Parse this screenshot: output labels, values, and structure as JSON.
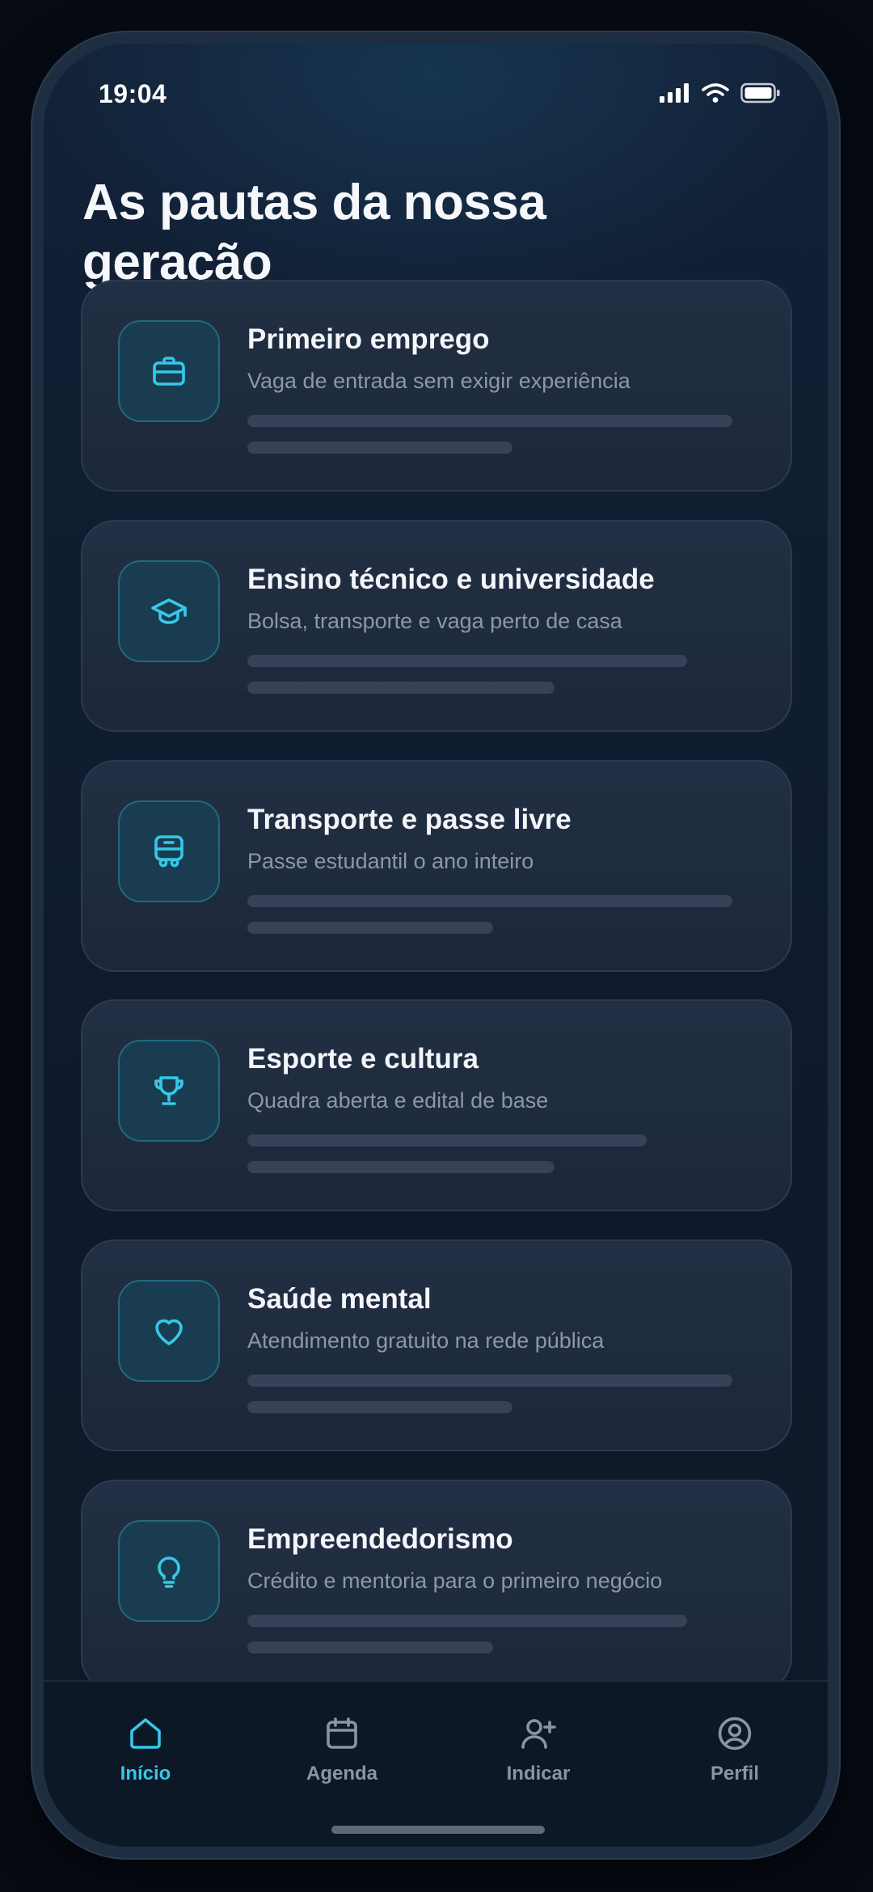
{
  "status_bar": {
    "time": "19:04",
    "icons": [
      "signal-icon",
      "wifi-icon",
      "battery-icon"
    ]
  },
  "header": {
    "title": "As pautas da nossa geração"
  },
  "cards": [
    {
      "title": "Primeiro emprego",
      "subtitle": "Vaga de entrada sem exigir experiência",
      "icon": "briefcase-icon"
    },
    {
      "title": "Ensino técnico e universidade",
      "subtitle": "Bolsa, transporte e vaga perto de casa",
      "icon": "graduation-cap-icon"
    },
    {
      "title": "Transporte e passe livre",
      "subtitle": "Passe estudantil o ano inteiro",
      "icon": "bus-icon"
    },
    {
      "title": "Esporte e cultura",
      "subtitle": "Quadra aberta e edital de base",
      "icon": "trophy-icon"
    },
    {
      "title": "Saúde mental",
      "subtitle": "Atendimento gratuito na rede pública",
      "icon": "heart-icon"
    },
    {
      "title": "Empreendedorismo",
      "subtitle": "Crédito e mentoria para o primeiro negócio",
      "icon": "lightbulb-icon"
    }
  ],
  "tabs": [
    {
      "label": "Início",
      "icon": "home-icon",
      "active": true
    },
    {
      "label": "Agenda",
      "icon": "calendar-icon",
      "active": false
    },
    {
      "label": "Indicar",
      "icon": "add-user-icon",
      "active": false
    },
    {
      "label": "Perfil",
      "icon": "profile-icon",
      "active": false
    }
  ],
  "colors": {
    "accent": "#35c8e8",
    "background": "#0f1b2d",
    "card": "#1f2b3e",
    "text_primary": "#f3f5f9",
    "text_secondary": "#8c97a8",
    "tab_inactive": "#8a94a4"
  }
}
